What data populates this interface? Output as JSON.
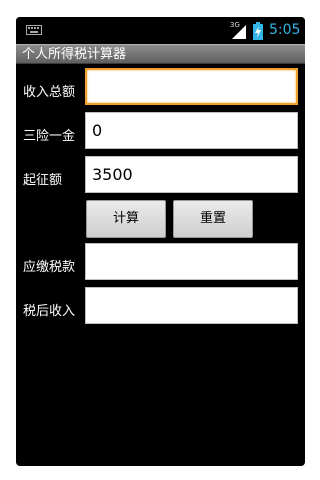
{
  "status_bar": {
    "network_label": "3G",
    "time": "5:05",
    "time_color": "#33b5e5"
  },
  "app": {
    "title": "个人所得税计算器"
  },
  "form": {
    "income_label": "收入总额",
    "income_value": "",
    "insurance_label": "三险一金",
    "insurance_value": "0",
    "threshold_label": "起征额",
    "threshold_value": "3500",
    "calculate_label": "计算",
    "reset_label": "重置",
    "tax_label": "应缴税款",
    "tax_value": "",
    "after_tax_label": "税后收入",
    "after_tax_value": ""
  },
  "colors": {
    "focus_border": "#f0a030",
    "background": "#000000",
    "title_bar": "#6e6e6e"
  }
}
